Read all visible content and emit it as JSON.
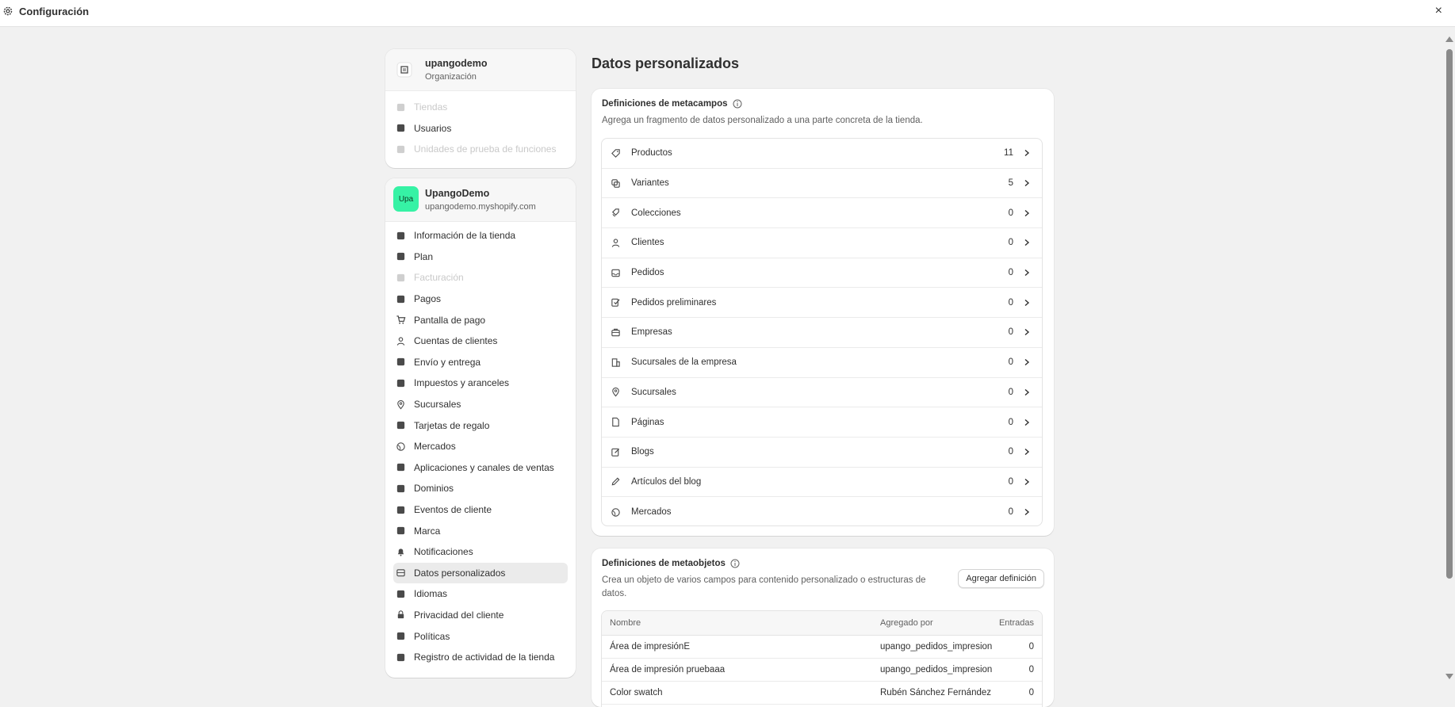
{
  "window": {
    "title": "Configuración",
    "close_label": "×"
  },
  "org": {
    "name": "upangodemo",
    "subtitle": "Organización",
    "items": [
      {
        "label": "Tiendas",
        "icon": "store-icon",
        "disabled": true
      },
      {
        "label": "Usuarios",
        "icon": "users-icon",
        "disabled": false
      },
      {
        "label": "Unidades de prueba de funciones",
        "icon": "flask-icon",
        "disabled": true
      }
    ]
  },
  "store": {
    "avatar": "Upa",
    "avatar_color": "#36f2a5",
    "name": "UpangoDemo",
    "domain": "upangodemo.myshopify.com",
    "items": [
      {
        "label": "Información de la tienda",
        "icon": "store-icon"
      },
      {
        "label": "Plan",
        "icon": "plan-icon"
      },
      {
        "label": "Facturación",
        "icon": "receipt-icon",
        "disabled": true
      },
      {
        "label": "Pagos",
        "icon": "payments-icon"
      },
      {
        "label": "Pantalla de pago",
        "icon": "cart-icon"
      },
      {
        "label": "Cuentas de clientes",
        "icon": "person-icon"
      },
      {
        "label": "Envío y entrega",
        "icon": "truck-icon"
      },
      {
        "label": "Impuestos y aranceles",
        "icon": "money-bag-icon"
      },
      {
        "label": "Sucursales",
        "icon": "location-icon"
      },
      {
        "label": "Tarjetas de regalo",
        "icon": "gift-card-icon"
      },
      {
        "label": "Mercados",
        "icon": "globe-icon"
      },
      {
        "label": "Aplicaciones y canales de ventas",
        "icon": "apps-icon"
      },
      {
        "label": "Dominios",
        "icon": "domain-icon"
      },
      {
        "label": "Eventos de cliente",
        "icon": "cursor-icon"
      },
      {
        "label": "Marca",
        "icon": "brand-icon"
      },
      {
        "label": "Notificaciones",
        "icon": "bell-icon"
      },
      {
        "label": "Datos personalizados",
        "icon": "database-icon",
        "active": true
      },
      {
        "label": "Idiomas",
        "icon": "language-icon"
      },
      {
        "label": "Privacidad del cliente",
        "icon": "lock-icon"
      },
      {
        "label": "Políticas",
        "icon": "policy-icon"
      },
      {
        "label": "Registro de actividad de la tienda",
        "icon": "activity-icon"
      }
    ]
  },
  "main": {
    "title": "Datos personalizados",
    "metafields": {
      "title": "Definiciones de metacampos",
      "description": "Agrega un fragmento de datos personalizado a una parte concreta de la tienda.",
      "rows": [
        {
          "label": "Productos",
          "count": "11",
          "icon": "tag-icon"
        },
        {
          "label": "Variantes",
          "count": "5",
          "icon": "variants-icon"
        },
        {
          "label": "Colecciones",
          "count": "0",
          "icon": "collection-icon"
        },
        {
          "label": "Clientes",
          "count": "0",
          "icon": "person-icon"
        },
        {
          "label": "Pedidos",
          "count": "0",
          "icon": "inbox-icon"
        },
        {
          "label": "Pedidos preliminares",
          "count": "0",
          "icon": "draft-order-icon"
        },
        {
          "label": "Empresas",
          "count": "0",
          "icon": "briefcase-icon"
        },
        {
          "label": "Sucursales de la empresa",
          "count": "0",
          "icon": "building-icon"
        },
        {
          "label": "Sucursales",
          "count": "0",
          "icon": "location-icon"
        },
        {
          "label": "Páginas",
          "count": "0",
          "icon": "page-icon"
        },
        {
          "label": "Blogs",
          "count": "0",
          "icon": "blog-icon"
        },
        {
          "label": "Artículos del blog",
          "count": "0",
          "icon": "pencil-icon"
        },
        {
          "label": "Mercados",
          "count": "0",
          "icon": "globe-icon"
        }
      ]
    },
    "metaobjects": {
      "title": "Definiciones de metaobjetos",
      "description_line1": "Crea un objeto de varios campos para contenido personalizado o estructuras de",
      "description_line2": "datos.",
      "add_button": "Agregar definición",
      "columns": [
        "Nombre",
        "Agregado por",
        "Entradas"
      ],
      "rows": [
        [
          "Área de impresiónE",
          "upango_pedidos_impresion",
          "0"
        ],
        [
          "Área de impresión pruebaaa",
          "upango_pedidos_impresion",
          "0"
        ],
        [
          "Color swatch",
          "Rubén Sánchez Fernández",
          "0"
        ]
      ]
    }
  }
}
